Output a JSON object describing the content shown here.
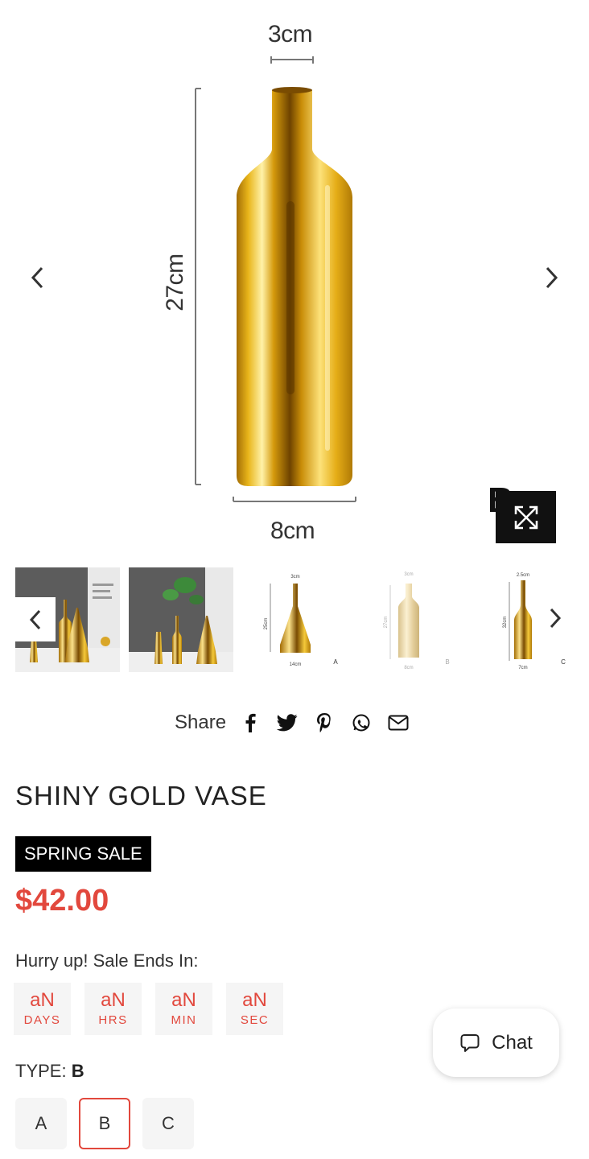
{
  "gallery": {
    "dims": {
      "top": "3cm",
      "side": "27cm",
      "bottom": "8cm"
    },
    "watermark": "B",
    "thumbnails": [
      {
        "name": "lifestyle-1"
      },
      {
        "name": "lifestyle-2"
      },
      {
        "name": "size-a",
        "dims": {
          "top": "3cm",
          "side": "25cm",
          "bottom": "14cm"
        },
        "tag": "A"
      },
      {
        "name": "size-b",
        "dims": {
          "top": "3cm",
          "side": "27cm",
          "bottom": "8cm"
        },
        "tag": "B"
      },
      {
        "name": "size-c",
        "dims": {
          "top": "2.5cm",
          "side": "32cm",
          "bottom": "7cm"
        },
        "tag": "C"
      }
    ]
  },
  "share": {
    "label": "Share",
    "icons": [
      "facebook-icon",
      "twitter-icon",
      "pinterest-icon",
      "whatsapp-icon",
      "email-icon"
    ]
  },
  "product": {
    "title": "SHINY GOLD VASE",
    "badge": "SPRING SALE",
    "price": "$42.00"
  },
  "countdown": {
    "label": "Hurry up! Sale Ends In:",
    "units": [
      {
        "value": "aN",
        "unit": "DAYS"
      },
      {
        "value": "aN",
        "unit": "HRS"
      },
      {
        "value": "aN",
        "unit": "MIN"
      },
      {
        "value": "aN",
        "unit": "SEC"
      }
    ]
  },
  "type_selector": {
    "label": "TYPE:",
    "selected": "B",
    "options": [
      "A",
      "B",
      "C"
    ]
  },
  "chat": {
    "label": "Chat"
  },
  "colors": {
    "accent": "#e2483d",
    "badge_bg": "#000000",
    "gold": "#d4a017"
  }
}
